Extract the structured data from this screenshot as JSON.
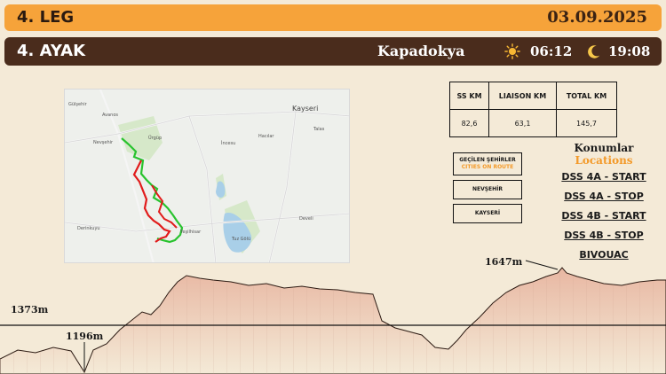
{
  "header": {
    "leg": "4. LEG",
    "date": "03.09.2025"
  },
  "stage": {
    "name": "4. AYAK",
    "region": "Kapadokya",
    "sunrise": "06:12",
    "sunset": "19:08",
    "sun_icon": "sun-icon",
    "moon_icon": "moon-icon"
  },
  "map": {
    "labels": [
      "Avanos",
      "Nevşehir",
      "Ürgüp",
      "Kayseri",
      "Talas",
      "Develi",
      "Yeşilhisar",
      "Derinkuyu",
      "Tuz Gölü",
      "Gülşehir",
      "Hacılar",
      "İncesu"
    ]
  },
  "stats": {
    "headers": [
      "SS KM",
      "LIAISON KM",
      "TOTAL KM"
    ],
    "values": [
      "82,6",
      "63,1",
      "145,7"
    ]
  },
  "cities": {
    "title_tr": "GEÇİLEN ŞEHİRLER",
    "title_en": "CITIES ON ROUTE",
    "items": [
      "NEVŞEHİR",
      "KAYSERİ"
    ]
  },
  "locations": {
    "title_tr": "Konumlar",
    "title_en": "Locations",
    "items": [
      "DSS 4A - START",
      "DSS 4A - STOP",
      "DSS 4B - START",
      "DSS 4B - STOP",
      "BIVOUAC"
    ]
  },
  "elevation": {
    "max_label": "1647m",
    "mid_label": "1373m",
    "min_label": "1196m"
  },
  "colors": {
    "accent": "#f6a33a",
    "dark": "#4a2c1c",
    "special": "#1e8c2a",
    "liaison": "#e11b1b"
  }
}
